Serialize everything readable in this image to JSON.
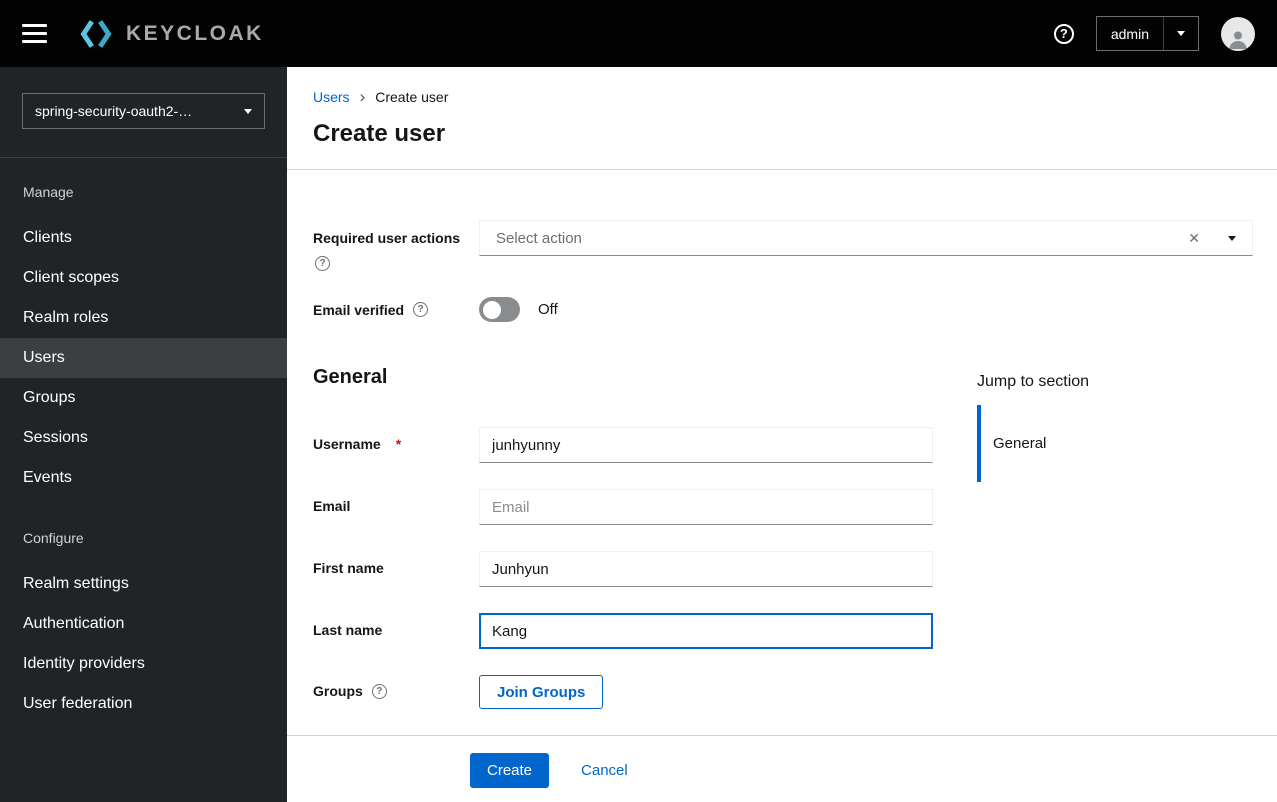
{
  "masthead": {
    "brand": "KEYCLOAK",
    "user_menu_label": "admin"
  },
  "sidebar": {
    "realm_selector": "spring-security-oauth2-…",
    "sections": [
      {
        "label": "Manage",
        "items": [
          {
            "label": "Clients"
          },
          {
            "label": "Client scopes"
          },
          {
            "label": "Realm roles"
          },
          {
            "label": "Users",
            "active": true
          },
          {
            "label": "Groups"
          },
          {
            "label": "Sessions"
          },
          {
            "label": "Events"
          }
        ]
      },
      {
        "label": "Configure",
        "items": [
          {
            "label": "Realm settings"
          },
          {
            "label": "Authentication"
          },
          {
            "label": "Identity providers"
          },
          {
            "label": "User federation"
          }
        ]
      }
    ]
  },
  "breadcrumb": {
    "parent": "Users",
    "current": "Create user"
  },
  "page": {
    "title": "Create user"
  },
  "form": {
    "required_user_actions": {
      "label": "Required user actions",
      "placeholder": "Select action"
    },
    "email_verified": {
      "label": "Email verified",
      "state": "Off"
    },
    "section_heading": "General",
    "username": {
      "label": "Username",
      "required_marker": "*",
      "value": "junhyunny"
    },
    "email": {
      "label": "Email",
      "placeholder": "Email",
      "value": ""
    },
    "first_name": {
      "label": "First name",
      "value": "Junhyun"
    },
    "last_name": {
      "label": "Last name",
      "value": "Kang"
    },
    "groups": {
      "label": "Groups",
      "join_button_label": "Join Groups"
    }
  },
  "jump_to_section": {
    "title": "Jump to section",
    "items": [
      {
        "label": "General",
        "active": true
      }
    ]
  },
  "actions": {
    "create_label": "Create",
    "cancel_label": "Cancel"
  },
  "icons": {
    "help_glyph": "?",
    "clear_glyph": "✕",
    "breadcrumb_separator": "›"
  },
  "colors": {
    "accent": "#0066cc",
    "masthead_bg": "#030303",
    "sidebar_bg": "#212427",
    "sidebar_active_bg": "#3c3f42",
    "required_marker": "#c9190b",
    "input_bottom_border": "#8a8d90"
  }
}
